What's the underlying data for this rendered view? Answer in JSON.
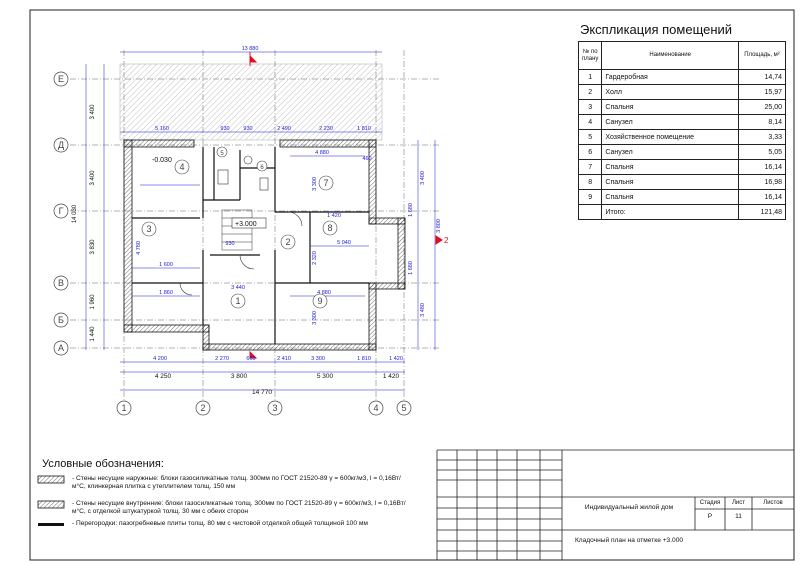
{
  "explication": {
    "title": "Экспликация помещений",
    "headers": {
      "num": "№ по плану",
      "name": "Наименование",
      "area": "Площадь, м²"
    },
    "rows": [
      {
        "num": "1",
        "name": "Гардеробная",
        "area": "14,74"
      },
      {
        "num": "2",
        "name": "Холл",
        "area": "15,97"
      },
      {
        "num": "3",
        "name": "Спальня",
        "area": "25,00"
      },
      {
        "num": "4",
        "name": "Санузел",
        "area": "8,14"
      },
      {
        "num": "5",
        "name": "Хозяйственное помещение",
        "area": "3,33"
      },
      {
        "num": "6",
        "name": "Санузел",
        "area": "5,05"
      },
      {
        "num": "7",
        "name": "Спальня",
        "area": "16,14"
      },
      {
        "num": "8",
        "name": "Спальня",
        "area": "16,98"
      },
      {
        "num": "9",
        "name": "Спальня",
        "area": "16,14"
      }
    ],
    "total_label": "Итого:",
    "total": "121,48"
  },
  "plan": {
    "axis_letters": [
      "Е",
      "Д",
      "Г",
      "В",
      "Б",
      "А"
    ],
    "axis_numbers": [
      "1",
      "2",
      "3",
      "4",
      "5"
    ],
    "room_numbers": [
      "1",
      "2",
      "3",
      "4",
      "5",
      "6",
      "7",
      "8",
      "9"
    ],
    "level_marks": {
      "ground": "-0.030",
      "floor": "+3.000"
    },
    "section_mark": "2",
    "top_overall": "13 880",
    "bottom_overall": "14 770",
    "bottom_segments": [
      "4 250",
      "3 800",
      "5 300",
      "1 420"
    ],
    "bottom_inner": [
      "4 200",
      "2 270",
      "660",
      "2 410",
      "3 300",
      "1 810",
      "1 420"
    ],
    "left_overall": "14 030",
    "left_segments": [
      "3 400",
      "3 400",
      "3 830",
      "1 960",
      "1 440"
    ],
    "right_segments": [
      "3 400",
      "3 480",
      "1 680",
      "3 800",
      "1 680"
    ],
    "top_inner": [
      "5 160",
      "930",
      "930",
      "2 490",
      "2 230",
      "1 810"
    ],
    "inner_labels": [
      "1 600",
      "1 860",
      "4 880",
      "930",
      "3 440",
      "1 420",
      "5 040",
      "4 780",
      "3 300",
      "2 320",
      "4 880",
      "3 300",
      "460"
    ]
  },
  "legend": {
    "title": "Условные обозначения:",
    "items": [
      "- Стены несущие наружные: блоки газосиликатные толщ. 300мм по ГОСТ 21520-89 γ = 600кг/м3,  l = 0,16Вт/м°С, клинкерная плитка с утеплителем толщ. 150 мм",
      "- Стены несущие внутренние: блоки газосиликатные толщ. 300мм по ГОСТ 21520-89 γ = 600кг/м3,  l = 0,16Вт/м°С, с отделкой штукатуркой толщ. 30 мм с обеих сторон",
      "- Перегородки: пазогребневые плиты толщ. 80 мм с чистовой отделкой общей толщиной 100 мм"
    ]
  },
  "stamp": {
    "project": "Индивидуальный жилой дом",
    "sheet_name": "Кладочный план на отметке +3.000",
    "col_stage": "Стадия",
    "col_sheet": "Лист",
    "col_sheets": "Листов",
    "stage": "Р",
    "sheet": "11",
    "sheets": ""
  },
  "colors": {
    "line": "#222222",
    "dim": "#1a1ad6",
    "red": "#e01020",
    "hatch": "#888888"
  }
}
